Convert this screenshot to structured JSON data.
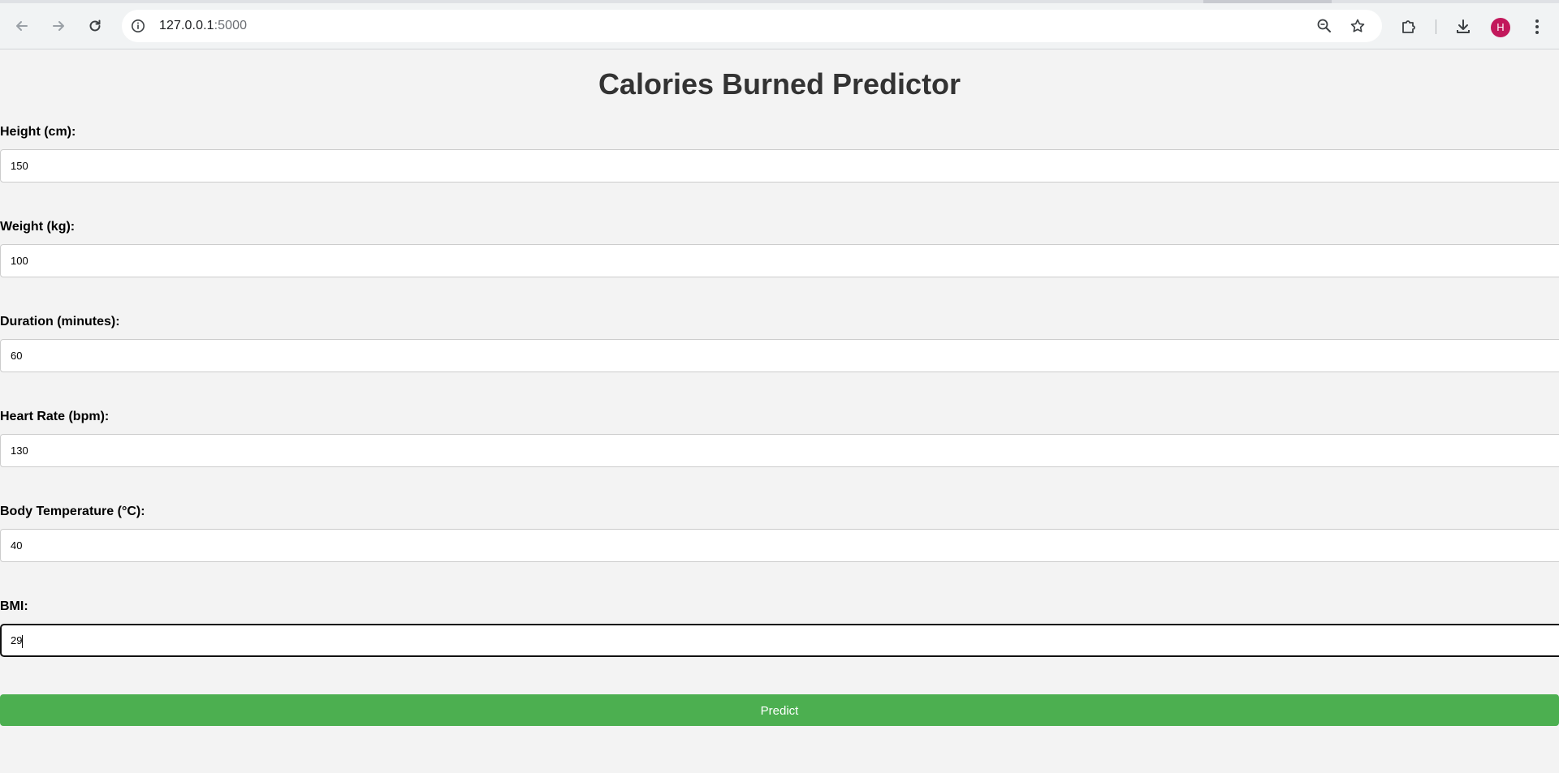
{
  "browser": {
    "url_host": "127.0.0.1",
    "url_port": ":5000",
    "avatar_initial": "H",
    "icons": {
      "back": "back-arrow-icon",
      "forward": "forward-arrow-icon",
      "reload": "reload-icon",
      "site_info": "info-icon",
      "zoom": "zoom-out-icon",
      "bookmark": "star-icon",
      "extensions": "puzzle-icon",
      "downloads": "download-icon",
      "menu": "kebab-menu-icon"
    },
    "avatar_color": "#c2185b"
  },
  "page": {
    "title": "Calories Burned Predictor",
    "fields": [
      {
        "label": "Height (cm):",
        "value": "150"
      },
      {
        "label": "Weight (kg):",
        "value": "100"
      },
      {
        "label": "Duration (minutes):",
        "value": "60"
      },
      {
        "label": "Heart Rate (bpm):",
        "value": "130"
      },
      {
        "label": "Body Temperature (°C):",
        "value": "40"
      },
      {
        "label": "BMI:",
        "value": "29"
      }
    ],
    "submit_label": "Predict",
    "colors": {
      "background": "#f3f3f3",
      "title": "#333333",
      "button": "#4caf50",
      "button_text": "#ffffff"
    }
  }
}
